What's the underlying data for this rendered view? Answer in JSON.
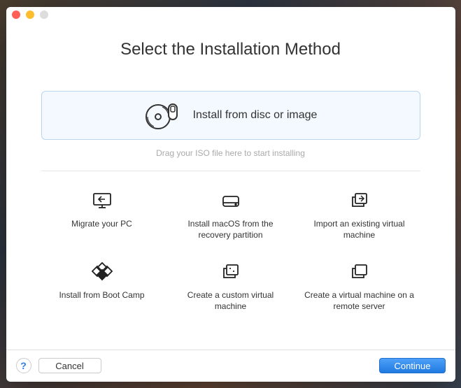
{
  "title": "Select the Installation Method",
  "primary": {
    "label": "Install from disc or image"
  },
  "hint": "Drag your ISO file here to start installing",
  "options": [
    {
      "label": "Migrate your PC"
    },
    {
      "label": "Install macOS from the recovery partition"
    },
    {
      "label": "Import an existing virtual machine"
    },
    {
      "label": "Install from Boot Camp"
    },
    {
      "label": "Create a custom virtual machine"
    },
    {
      "label": "Create a virtual machine on a remote server"
    }
  ],
  "footer": {
    "cancel": "Cancel",
    "continue": "Continue"
  }
}
